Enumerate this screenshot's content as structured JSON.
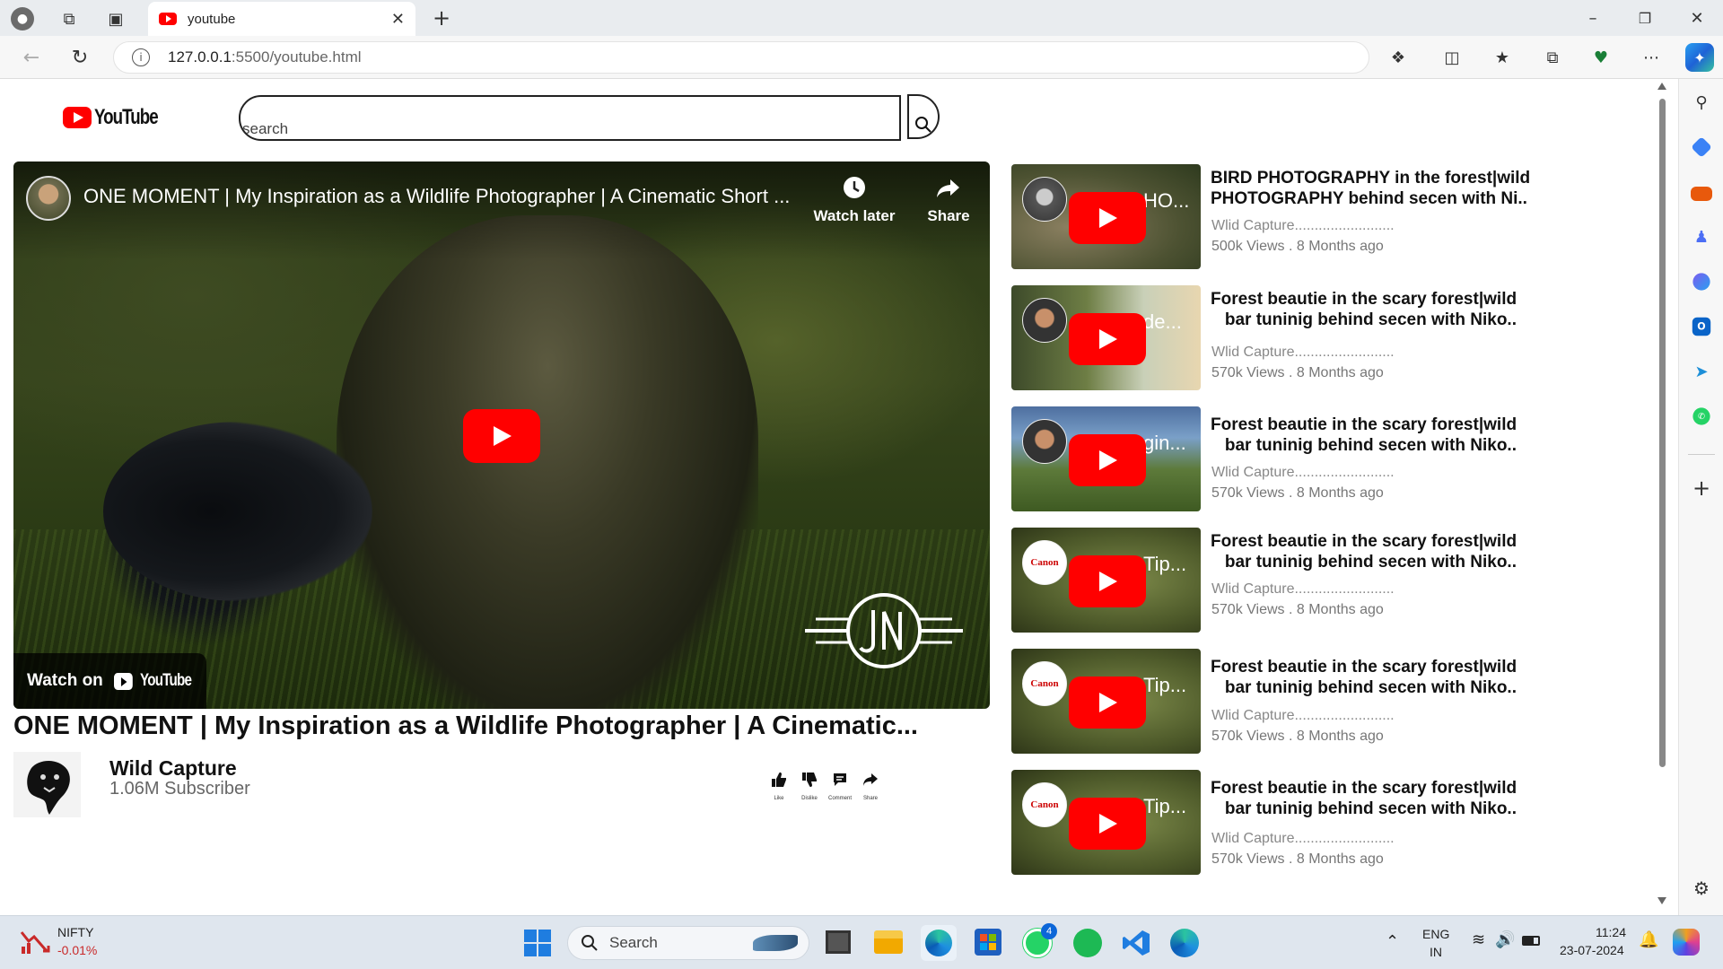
{
  "browser": {
    "tab_title": "youtube",
    "url_host": "127.0.0.1",
    "url_rest": ":5500/youtube.html"
  },
  "site": {
    "logo_text": "YouTube",
    "search_placeholder": "search"
  },
  "player": {
    "title": "ONE MOMENT | My Inspiration as a Wildlife Photographer | A Cinematic Short ...",
    "watch_later": "Watch later",
    "share": "Share",
    "watch_on": "Watch on",
    "watch_on_brand": "YouTube"
  },
  "video": {
    "title": "ONE MOMENT | My Inspiration as a Wildlife Photographer | A Cinematic...",
    "channel": "Wild Capture",
    "subscribers": "1.06M Subscriber",
    "actions": [
      {
        "label": "Like",
        "icon": "thumbs-up-icon"
      },
      {
        "label": "Dislike",
        "icon": "thumbs-down-icon"
      },
      {
        "label": "Comment",
        "icon": "comment-icon"
      },
      {
        "label": "Share",
        "icon": "share-icon"
      }
    ]
  },
  "related": [
    {
      "thumb_text": "HO...",
      "title_line1": "BIRD PHOTOGRAPHY in the forest|wild",
      "title_line2": "PHOTOGRAPHY behind secen with Ni..",
      "channel": "Wlid Capture.........................",
      "meta": "500k Views . 8 Months ago"
    },
    {
      "thumb_text": "de...",
      "title_line1": "Forest beautie in the scary forest|wild",
      "title_line2": "bar tuninig behind secen with Niko..",
      "channel": "Wlid Capture.........................",
      "meta": "570k Views . 8 Months ago"
    },
    {
      "thumb_text": "gin...",
      "title_line1": "Forest beautie in the scary forest|wild",
      "title_line2": "bar tuninig behind secen with Niko..",
      "channel": "Wlid Capture.........................",
      "meta": "570k Views . 8 Months ago"
    },
    {
      "thumb_text": "Tip...",
      "title_line1": "Forest beautie in the scary forest|wild",
      "title_line2": "bar tuninig behind secen with Niko..",
      "channel": "Wlid Capture.........................",
      "meta": "570k Views . 8 Months ago"
    },
    {
      "thumb_text": "Tip...",
      "title_line1": "Forest beautie in the scary forest|wild",
      "title_line2": "bar tuninig behind secen with Niko..",
      "channel": "Wlid Capture.........................",
      "meta": "570k Views . 8 Months ago"
    },
    {
      "thumb_text": "Tip...",
      "title_line1": "Forest beautie in the scary forest|wild",
      "title_line2": "bar tuninig behind secen with Niko..",
      "channel": "Wlid Capture.........................",
      "meta": "570k Views . 8 Months ago"
    }
  ],
  "taskbar": {
    "stock_name": "NIFTY",
    "stock_change": "-0.01%",
    "search_label": "Search",
    "lang_line1": "ENG",
    "lang_line2": "IN",
    "time": "11:24",
    "date": "23-07-2024",
    "whatsapp_badge": "4"
  },
  "colors": {
    "youtube_red": "#ff0000",
    "accent_blue": "#0b66d8"
  }
}
